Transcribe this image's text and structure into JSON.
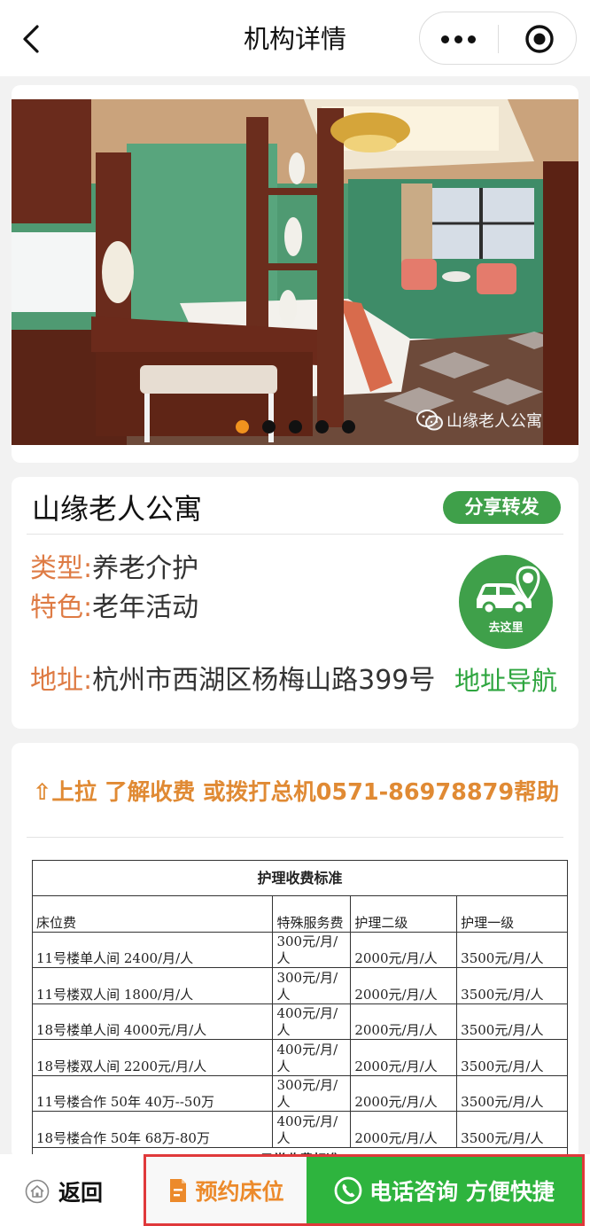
{
  "navbar": {
    "title": "机构详情",
    "back_icon": "back-arrow-icon",
    "more_icon": "more-dots-icon",
    "close_icon": "target-circle-icon"
  },
  "carousel": {
    "watermark": "山缘老人公寓",
    "slide_count": 5,
    "active_index": 0,
    "active_dot_color": "#f0921e"
  },
  "info": {
    "name": "山缘老人公寓",
    "share_label": "分享转发",
    "type_label": "类型:",
    "type_value": "养老介护",
    "feature_label": "特色:",
    "feature_value": "老年活动",
    "address_label": "地址:",
    "address_value": "杭州市西湖区杨梅山路399号",
    "nav_link": "地址导航",
    "goto_label": "去这里",
    "label_color": "#de7b44",
    "accent_green": "#3fa04a"
  },
  "fees": {
    "tip": "⇧上拉 了解收费 或拨打总机0571-86978879帮助",
    "table_title": "护理收费标准",
    "headers": [
      "床位费",
      "特殊服务费",
      "护理二级",
      "护理一级"
    ],
    "rows": [
      [
        "11号楼单人间 2400/月/人",
        "300元/月/人",
        "2000元/月/人",
        "3500元/月/人"
      ],
      [
        "11号楼双人间 1800/月/人",
        "300元/月/人",
        "2000元/月/人",
        "3500元/月/人"
      ],
      [
        "18号楼单人间 4000元/月/人",
        "400元/月/人",
        "2000元/月/人",
        "3500元/月/人"
      ],
      [
        "18号楼双人间 2200元/月/人",
        "400元/月/人",
        "2000元/月/人",
        "3500元/月/人"
      ],
      [
        "11号楼合作 50年 40万--50万",
        "300元/月/人",
        "2000元/月/人",
        "3500元/月/人"
      ],
      [
        "18号楼合作 50年 68万-80万",
        "400元/月/人",
        "2000元/月/人",
        "3500元/月/人"
      ]
    ],
    "cut_off_heading": "日常收费标准"
  },
  "bottom": {
    "back_label": "返回",
    "reserve_label": "预约床位",
    "call_label": "电话咨询 方便快捷",
    "reserve_color": "#ec8a2b",
    "call_bg": "#2eb43e",
    "highlight_border": "#e0393b"
  }
}
